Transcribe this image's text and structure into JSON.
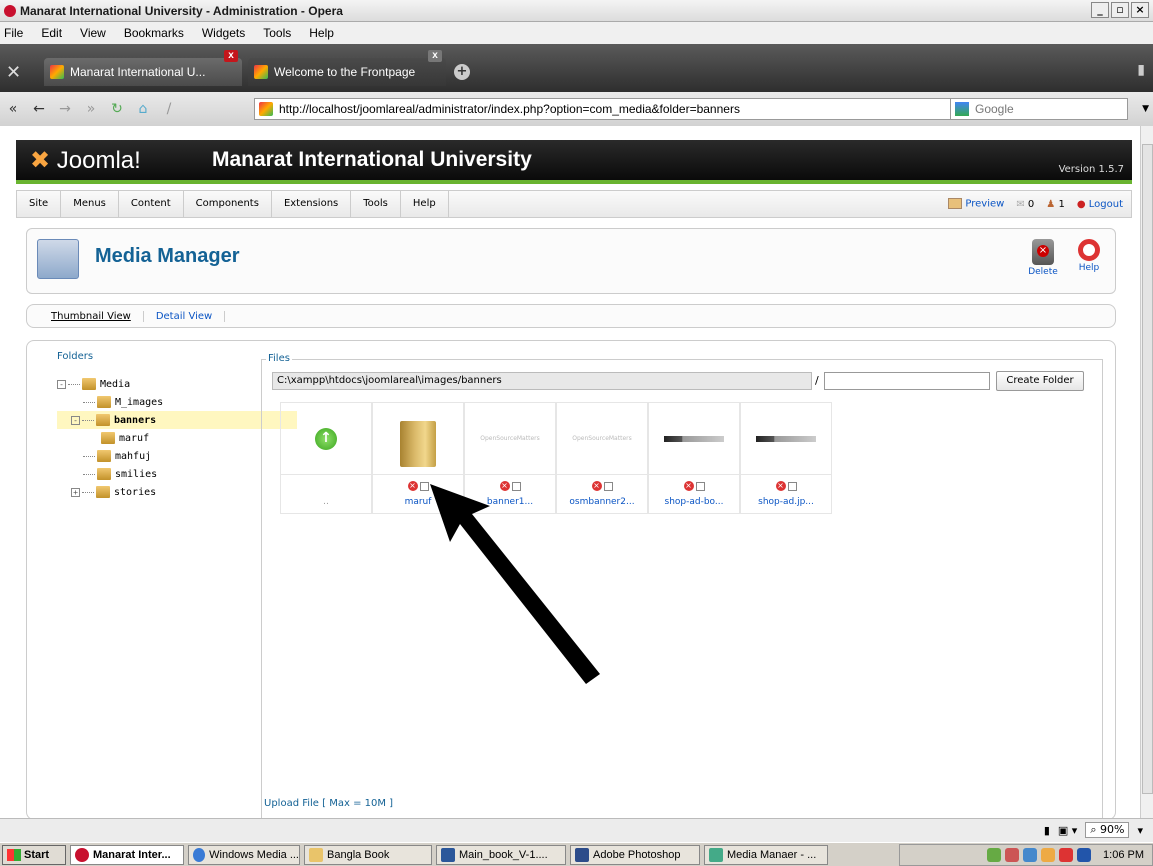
{
  "window": {
    "title": "Manarat International University - Administration - Opera"
  },
  "menubar": [
    "File",
    "Edit",
    "View",
    "Bookmarks",
    "Widgets",
    "Tools",
    "Help"
  ],
  "tabs": [
    {
      "label": "Manarat International U...",
      "active": true
    },
    {
      "label": "Welcome to the Frontpage",
      "active": false
    }
  ],
  "address": {
    "url": "http://localhost/joomlareal/administrator/index.php?option=com_media&folder=banners",
    "search_placeholder": "Google"
  },
  "joomla": {
    "logo": "Joomla!",
    "site_name": "Manarat International University",
    "version": "Version 1.5.7",
    "menu": [
      "Site",
      "Menus",
      "Content",
      "Components",
      "Extensions",
      "Tools",
      "Help"
    ],
    "preview": "Preview",
    "messages_count": "0",
    "users_count": "1",
    "logout": "Logout"
  },
  "page": {
    "title": "Media Manager",
    "toolbar": {
      "delete": "Delete",
      "help": "Help"
    },
    "view_tabs": {
      "thumbnail": "Thumbnail View",
      "detail": "Detail View"
    },
    "folders_legend": "Folders",
    "files_legend": "Files",
    "tree": [
      {
        "label": "Media",
        "depth": 0,
        "expander": "-"
      },
      {
        "label": "M_images",
        "depth": 1,
        "expander": ""
      },
      {
        "label": "banners",
        "depth": 1,
        "expander": "-",
        "selected": true
      },
      {
        "label": "maruf",
        "depth": 2,
        "expander": ""
      },
      {
        "label": "mahfuj",
        "depth": 1,
        "expander": ""
      },
      {
        "label": "smilies",
        "depth": 1,
        "expander": ""
      },
      {
        "label": "stories",
        "depth": 1,
        "expander": "+"
      }
    ],
    "path": "C:\\xampp\\htdocs\\joomlareal\\images/banners",
    "path_sep": "/",
    "create_folder": "Create Folder",
    "items": [
      {
        "name": "..",
        "kind": "up"
      },
      {
        "name": "maruf",
        "kind": "folder"
      },
      {
        "name": "banner1...",
        "kind": "image",
        "thumb_text": "OpenSourceMatters"
      },
      {
        "name": "osmbanner2...",
        "kind": "image",
        "thumb_text": "OpenSourceMatters"
      },
      {
        "name": "shop-ad-bo...",
        "kind": "image"
      },
      {
        "name": "shop-ad.jp...",
        "kind": "image"
      }
    ],
    "upload_legend": "Upload File [ Max = 10M ]"
  },
  "status": {
    "zoom": "90%"
  },
  "taskbar": {
    "start": "Start",
    "tasks": [
      "Manarat Inter...",
      "Windows Media ...",
      "Bangla Book",
      "Main_book_V-1....",
      "Adobe Photoshop",
      "Media Manaer - ..."
    ],
    "clock": "1:06 PM"
  },
  "colors": {
    "joomla_green": "#69b430",
    "link_blue": "#0b55c4",
    "title_blue": "#146295"
  }
}
